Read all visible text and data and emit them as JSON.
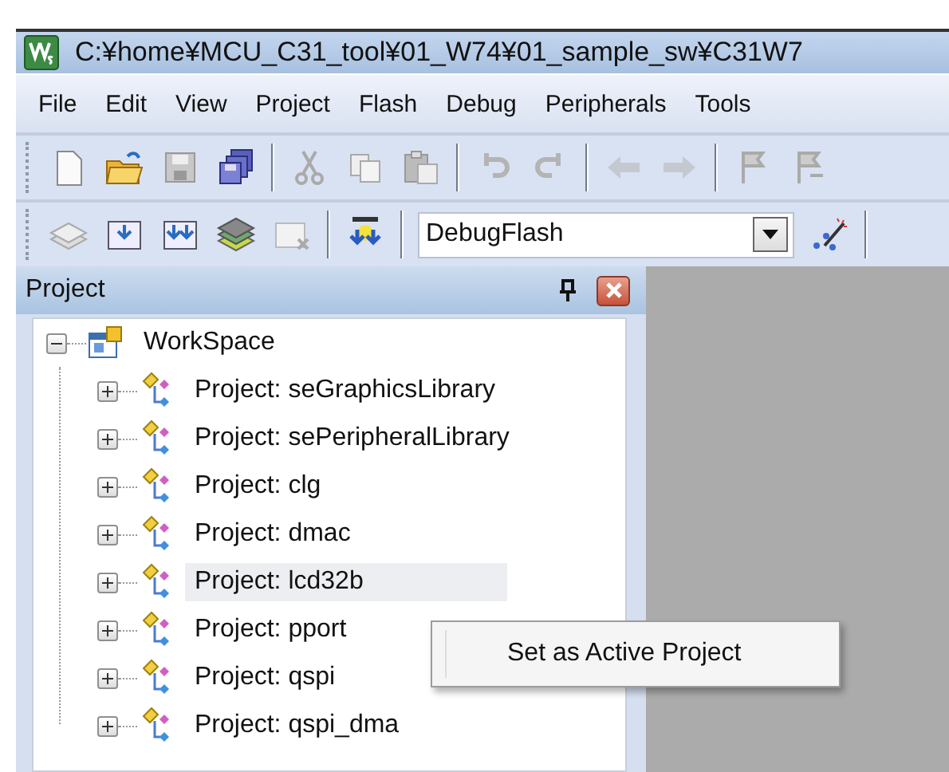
{
  "window": {
    "title": "C:¥home¥MCU_C31_tool¥01_W74¥01_sample_sw¥C31W7"
  },
  "menu": [
    {
      "label": "File"
    },
    {
      "label": "Edit"
    },
    {
      "label": "View"
    },
    {
      "label": "Project"
    },
    {
      "label": "Flash"
    },
    {
      "label": "Debug"
    },
    {
      "label": "Peripherals"
    },
    {
      "label": "Tools"
    }
  ],
  "build_config": {
    "value": "DebugFlash"
  },
  "panel": {
    "title": "Project"
  },
  "tree": [
    {
      "label": "WorkSpace",
      "expanded": true,
      "highlighted": false,
      "children": [
        {
          "label": "Project: seGraphicsLibrary",
          "expanded": false,
          "highlighted": false
        },
        {
          "label": "Project: sePeripheralLibrary",
          "expanded": false,
          "highlighted": false
        },
        {
          "label": "Project: clg",
          "expanded": false,
          "highlighted": false
        },
        {
          "label": "Project: dmac",
          "expanded": false,
          "highlighted": false
        },
        {
          "label": "Project: lcd32b",
          "expanded": false,
          "highlighted": true
        },
        {
          "label": "Project: pport",
          "expanded": false,
          "highlighted": false
        },
        {
          "label": "Project: qspi",
          "expanded": false,
          "highlighted": false
        },
        {
          "label": "Project: qspi_dma",
          "expanded": false,
          "highlighted": false
        }
      ]
    }
  ],
  "context_menu": [
    {
      "label": "Set as Active Project"
    }
  ]
}
